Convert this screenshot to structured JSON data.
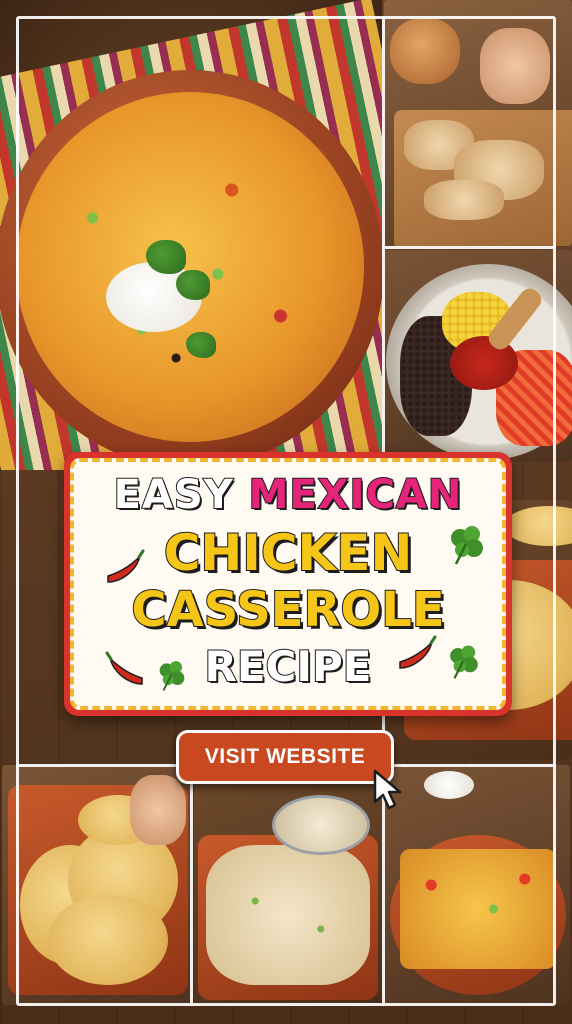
{
  "title": {
    "word1": "EASY",
    "word2": "MEXICAN",
    "line2": "CHICKEN",
    "line3": "CASSEROLE",
    "line4": "RECIPE"
  },
  "cta": {
    "label": "VISIT WEBSITE"
  },
  "colors": {
    "title_pink": "#e6257a",
    "title_yellow": "#f5c518",
    "card_border": "#d9332b",
    "button_bg": "#c9481f"
  },
  "icons": [
    "chili-pepper-icon",
    "cilantro-leaf-icon",
    "pointer-cursor-icon"
  ]
}
